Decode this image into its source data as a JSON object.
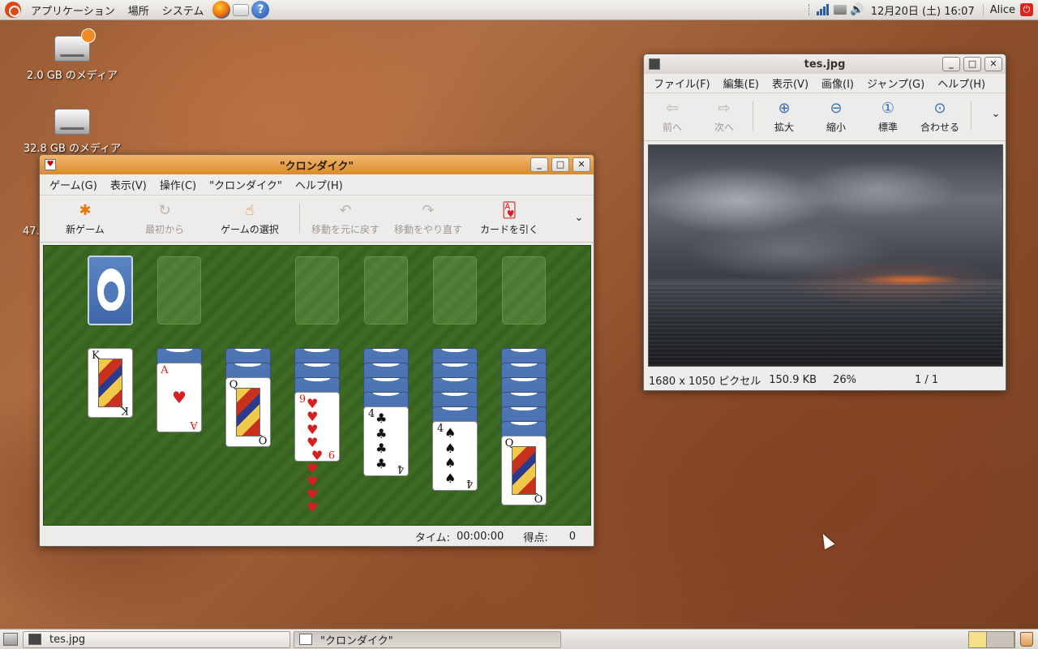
{
  "top_panel": {
    "menus": [
      "アプリケーション",
      "場所",
      "システム"
    ],
    "clock": "12月20日 (土) 16:07",
    "user": "Alice"
  },
  "desktop_icons": [
    {
      "label": "2.0 GB のメディア"
    },
    {
      "label": "32.8 GB のメディア"
    },
    {
      "label": "47."
    }
  ],
  "solitaire": {
    "title": "\"クロンダイク\"",
    "menu": [
      "ゲーム(G)",
      "表示(V)",
      "操作(C)",
      "\"クロンダイク\"",
      "ヘルプ(H)"
    ],
    "toolbar": {
      "new_game": "新ゲーム",
      "restart": "最初から",
      "select_game": "ゲームの選択",
      "undo": "移動を元に戻す",
      "redo": "移動をやり直す",
      "deal": "カードを引く"
    },
    "status": {
      "time_label": "タイム:",
      "time": "00:00:00",
      "score_label": "得点:",
      "score": "0"
    },
    "tableau_top_cards": [
      {
        "rank": "K",
        "suit": "♣",
        "color": "black"
      },
      {
        "rank": "A",
        "suit": "♥",
        "color": "red"
      },
      {
        "rank": "Q",
        "suit": "♠",
        "color": "black"
      },
      {
        "rank": "9",
        "suit": "♥",
        "color": "red"
      },
      {
        "rank": "4",
        "suit": "♣",
        "color": "black"
      },
      {
        "rank": "4",
        "suit": "♠",
        "color": "black"
      },
      {
        "rank": "Q",
        "suit": "♣",
        "color": "black"
      }
    ]
  },
  "viewer": {
    "title": "tes.jpg",
    "menu": [
      "ファイル(F)",
      "編集(E)",
      "表示(V)",
      "画像(I)",
      "ジャンプ(G)",
      "ヘルプ(H)"
    ],
    "toolbar": {
      "prev": "前へ",
      "next": "次へ",
      "zoom_in": "拡大",
      "zoom_out": "縮小",
      "normal": "標準",
      "fit": "合わせる"
    },
    "status": {
      "dimensions": "1680 x 1050 ピクセル",
      "size": "150.9 KB",
      "zoom": "26%",
      "page": "1 / 1"
    }
  },
  "taskbar": {
    "tasks": [
      {
        "label": "tes.jpg",
        "active": false
      },
      {
        "label": "\"クロンダイク\"",
        "active": true
      }
    ]
  },
  "colors": {
    "active_titlebar": "#d98b2c",
    "felt": "#3e6b24",
    "card_back": "#4f77b5"
  }
}
